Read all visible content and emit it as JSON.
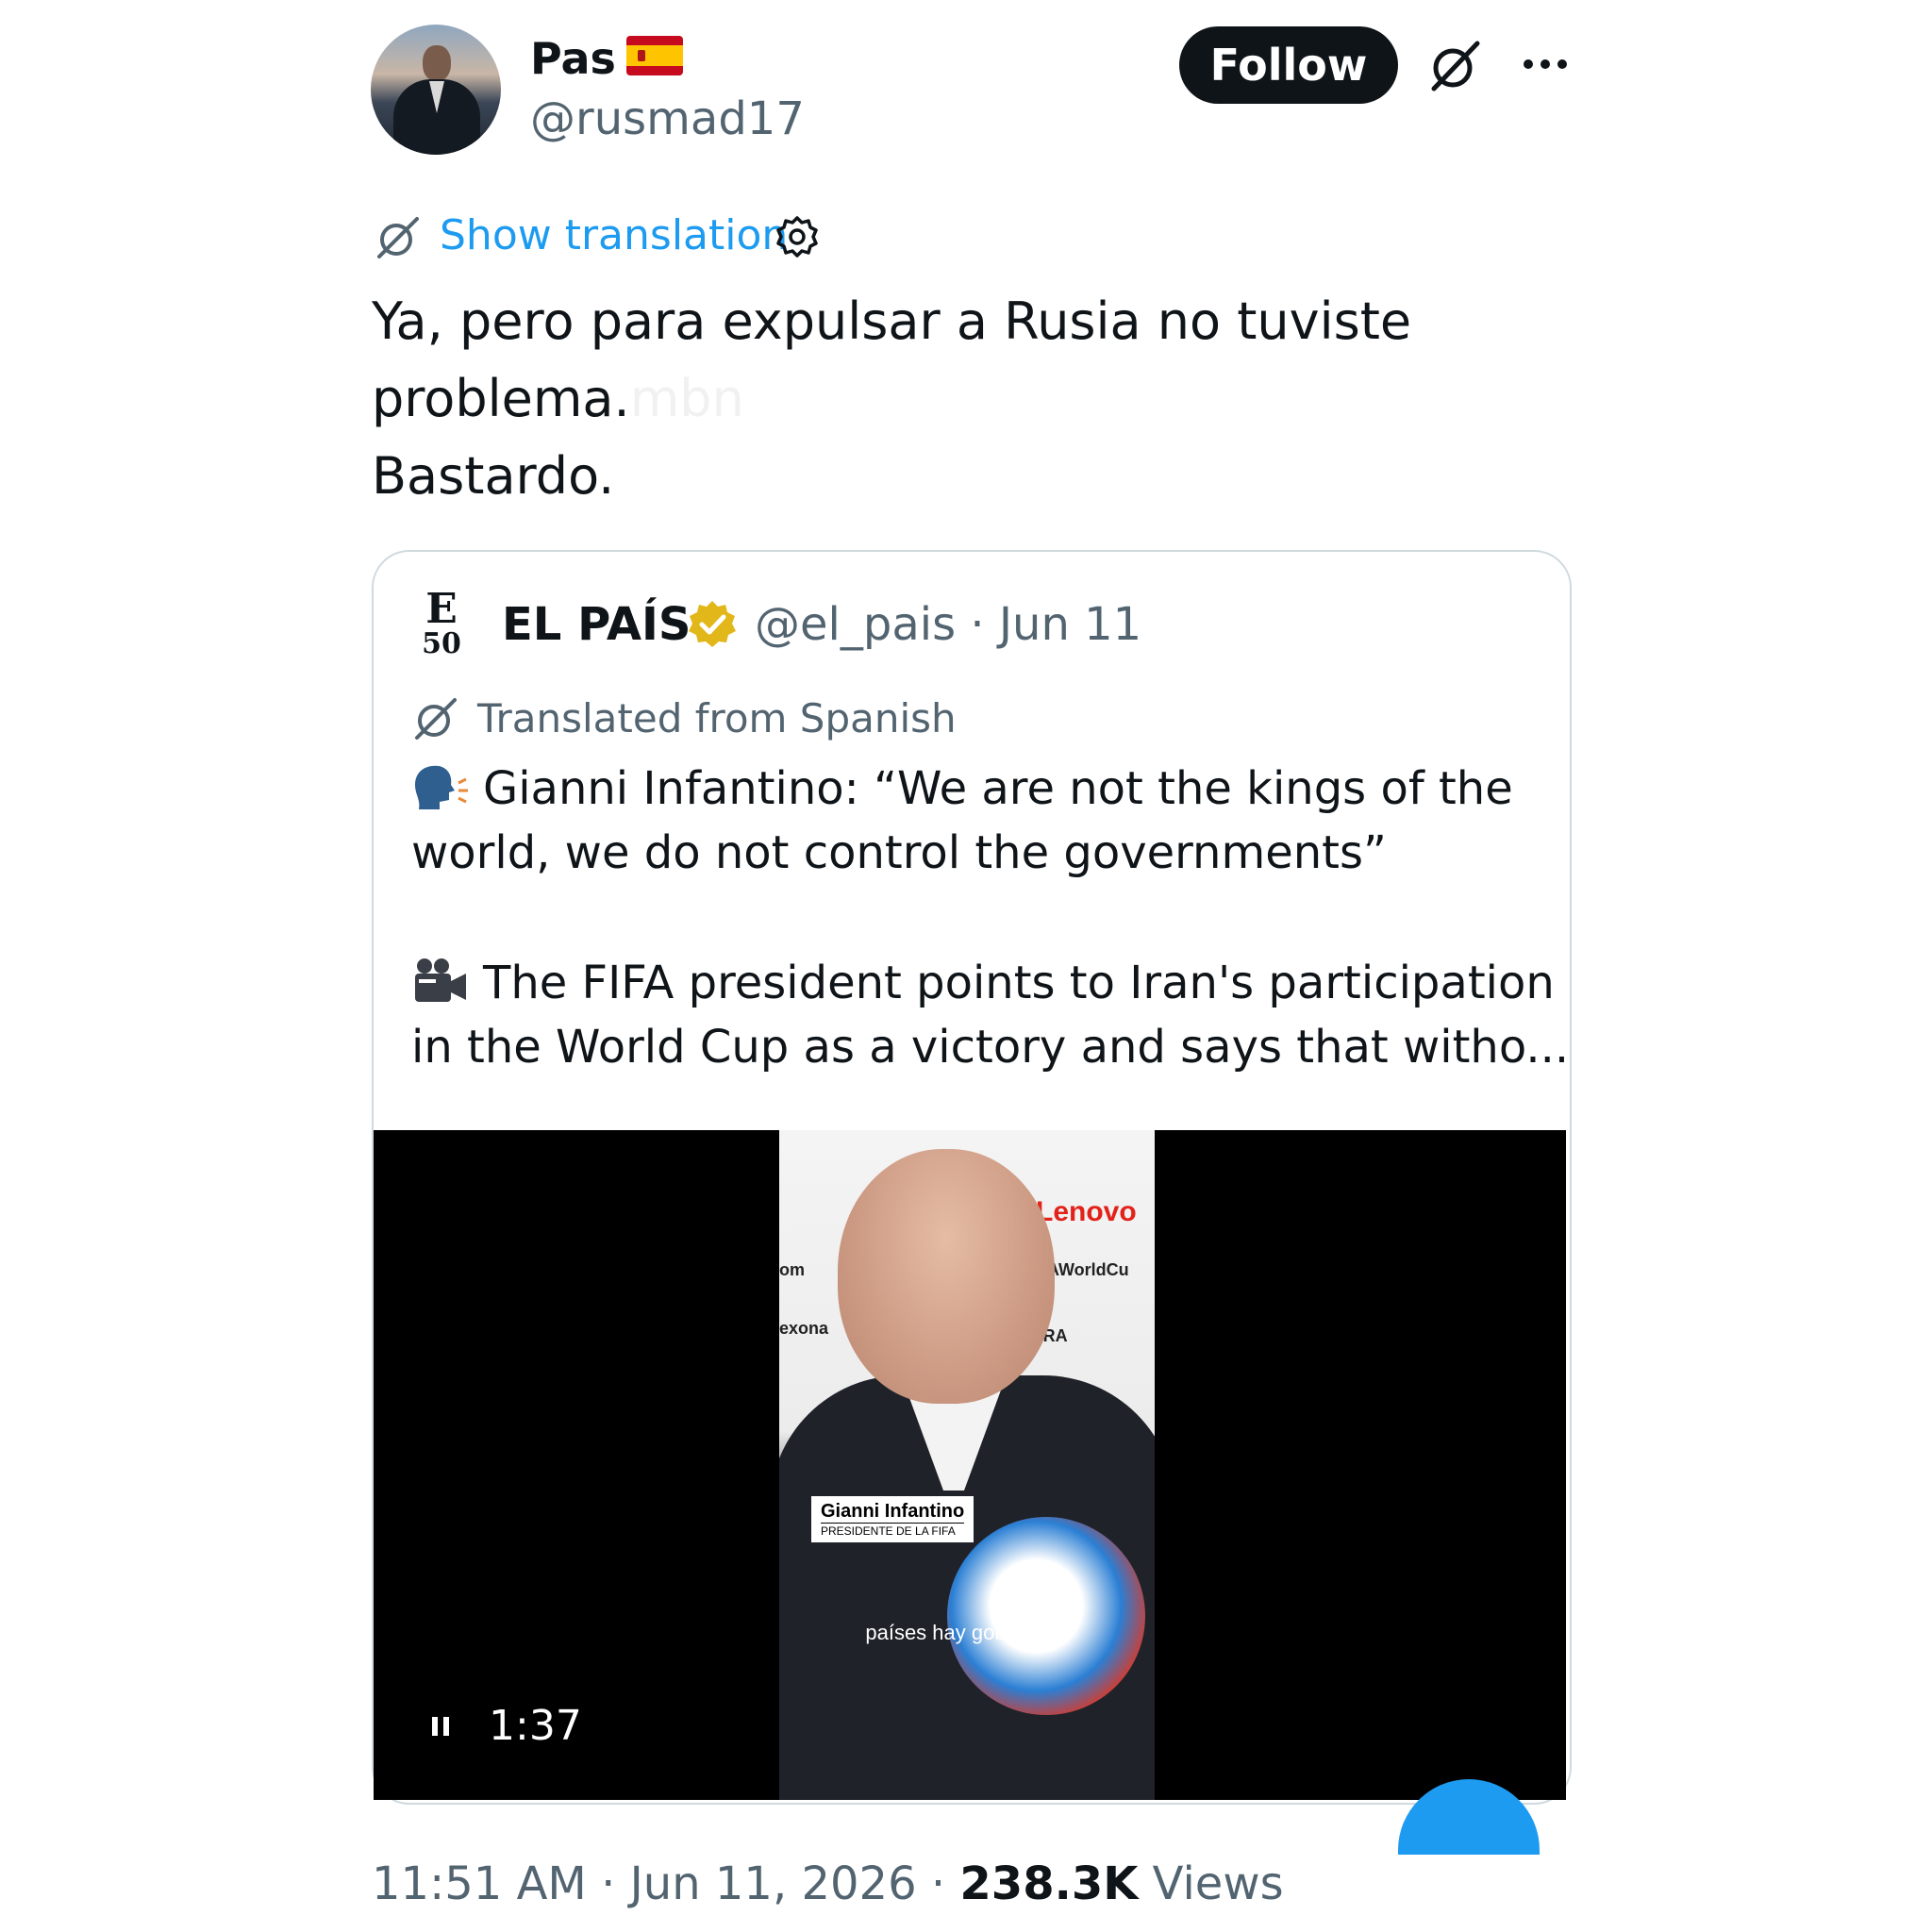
{
  "author": {
    "name": "Pas",
    "flag_emoji": "🇪🇸",
    "handle": "@rusmad17"
  },
  "actions": {
    "follow_label": "Follow",
    "grok_icon": "grok-icon",
    "more_icon": "more-horizontal-icon"
  },
  "translation": {
    "show_label": "Show translation"
  },
  "tweet": {
    "lines": [
      "Ya, pero para expulsar a Rusia no tuviste",
      "problema.",
      "Bastardo."
    ],
    "watermark": "mbn"
  },
  "quoted": {
    "logo_letter": "E",
    "logo_number": "50",
    "name": "EL PAÍS",
    "handle_date": "@el_pais · Jun 11",
    "translated_label": "Translated from Spanish",
    "line1": "Gianni Infantino: “We are not the kings of the",
    "line2": "world, we do not control the governments”",
    "line3": "The FIFA president points to Iran's participation",
    "line4": "in the World Cup as a victory and says that witho...",
    "video": {
      "duration": "1:37",
      "lower_third_name": "Gianni Infantino",
      "lower_third_role": "PRESIDENTE DE LA FIFA",
      "subtitle": "países hay gobiernos.",
      "sponsor_1": "Lenovo",
      "sponsor_2": "FIFAWorldCu",
      "sponsor_3": "om",
      "sponsor_4": "exona",
      "sponsor_5": "ULTRA"
    }
  },
  "footer": {
    "timestamp": "11:51 AM · Jun 11, 2026 · ",
    "views_count": "238.3K",
    "views_label": " Views"
  },
  "colors": {
    "accent": "#1d9bf0",
    "secondary_text": "#536471",
    "primary_text": "#0f1419",
    "verified_gold": "#e2b719"
  }
}
